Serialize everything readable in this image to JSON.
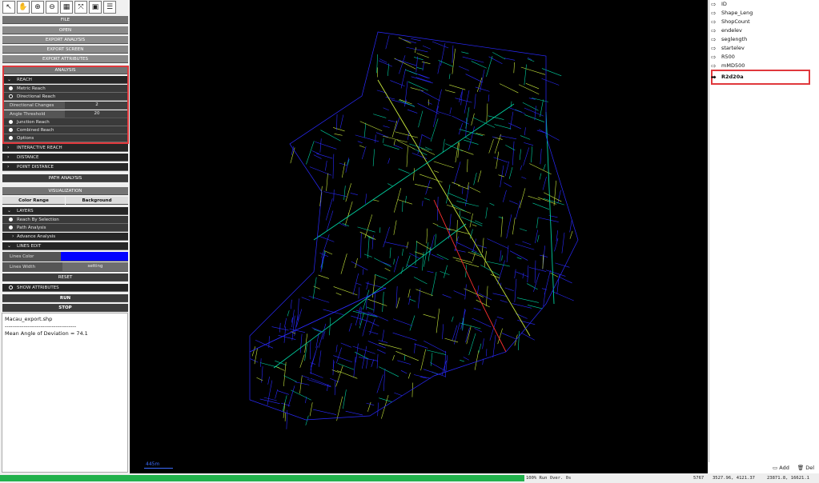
{
  "toolbar": {
    "tools": [
      {
        "icon": "select-arrow-icon",
        "glyph": "↖"
      },
      {
        "icon": "pan-hand-icon",
        "glyph": "✋"
      },
      {
        "icon": "zoom-in-icon",
        "glyph": "⊕"
      },
      {
        "icon": "zoom-out-icon",
        "glyph": "⊖"
      },
      {
        "icon": "grid-icon",
        "glyph": "▦"
      },
      {
        "icon": "fit-extent-icon",
        "glyph": "⤧"
      },
      {
        "icon": "layer-select-icon",
        "glyph": "▣"
      },
      {
        "icon": "list-icon",
        "glyph": "☰"
      }
    ]
  },
  "menu": {
    "file": "FILE",
    "open": "OPEN",
    "export_analysis": "EXPORT ANALYSIS",
    "export_screen": "EXPORT SCREEN",
    "export_attributes": "EXPORT ATTRIBUTES"
  },
  "analysis": {
    "title": "ANALYSIS",
    "reach": "REACH",
    "metric_reach": "Metric Reach",
    "directional_reach": "Directional Reach",
    "directional_changes_label": "Directional Changes",
    "directional_changes_value": "2",
    "angle_threshold_label": "Angle Threshold",
    "angle_threshold_value": "20",
    "junction_reach": "Junction Reach",
    "combined_reach": "Combined Reach",
    "options": "Options",
    "interactive_reach": "INTERACTIVE REACH",
    "distance": "DISTANCE",
    "point_distance": "POINT DISTANCE",
    "path_analysis": "PATH ANALYSIS"
  },
  "visualization": {
    "title": "VISUALIZATION",
    "color_range": "Color Range",
    "background": "Background",
    "layers": "LAYERS",
    "reach_by_selection": "Reach By Selection",
    "path_analysis": "Path Analysis",
    "advance_analysis": "Advance Analysis",
    "lines_edit": "LINES EDIT",
    "lines_color_label": "Lines Color",
    "lines_color": "#0000ff",
    "lines_width_label": "Lines Width",
    "lines_width_button": "setting",
    "reset": "RESET",
    "show_attributes": "SHOW ATTRIBUTES",
    "run": "RUN",
    "stop": "STOP"
  },
  "console": {
    "file": "Macau_export.shp",
    "separator": "--------------------------------------",
    "result": "Mean Angle of Deviation = 74.1"
  },
  "map": {
    "scale_label": "445m",
    "colors": {
      "low": "#2a2aff",
      "mid": "#00d0a0",
      "high_mid": "#c8e83c",
      "high": "#ff3030"
    }
  },
  "attributes": {
    "items": [
      "ID",
      "Shape_Leng",
      "ShopCount",
      "endelev",
      "seglength",
      "startelev",
      "R500",
      "mMD500",
      "R2d20a"
    ],
    "selected": "R2d20a",
    "add": "Add",
    "del": "Del"
  },
  "status": {
    "progress_percent": 64,
    "message": "100% Run Over. 0s",
    "count": "5767",
    "coord1": "3527.96, 4121.37",
    "coord2": "23871.8, 16621.1"
  }
}
